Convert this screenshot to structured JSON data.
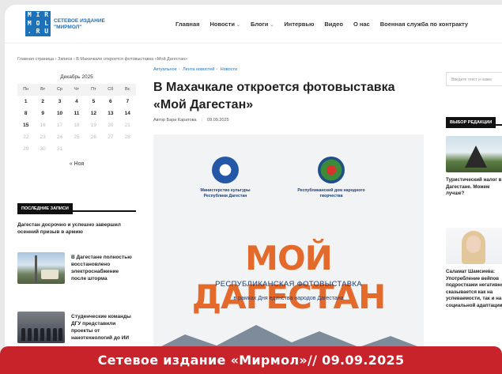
{
  "logo": {
    "letters": [
      "M",
      "I",
      "R",
      "M",
      "O",
      "L",
      ".",
      "R",
      "U"
    ],
    "title_line1": "СЕТЕВОЕ ИЗДАНИЕ",
    "title_line2": "\"МИРМОЛ\""
  },
  "nav": [
    {
      "label": "Главная",
      "dropdown": false
    },
    {
      "label": "Новости",
      "dropdown": true
    },
    {
      "label": "Блоги",
      "dropdown": true
    },
    {
      "label": "Интервью",
      "dropdown": false
    },
    {
      "label": "Видео",
      "dropdown": false
    },
    {
      "label": "О нас",
      "dropdown": false
    },
    {
      "label": "Военная служба по контракту",
      "dropdown": false
    }
  ],
  "breadcrumb": "Главная страница › Записи › В Махачкале откроется фотовыставка «Мой Дагестан»",
  "calendar": {
    "title": "Декабрь 2025",
    "weekdays": [
      "Пн",
      "Вт",
      "Ср",
      "Чт",
      "Пт",
      "Сб",
      "Вс"
    ],
    "days": [
      [
        "1",
        "2",
        "3",
        "4",
        "5",
        "6",
        "7"
      ],
      [
        "8",
        "9",
        "10",
        "11",
        "12",
        "13",
        "14"
      ],
      [
        "15",
        "16",
        "17",
        "18",
        "19",
        "20",
        "21"
      ],
      [
        "22",
        "23",
        "24",
        "25",
        "26",
        "27",
        "28"
      ],
      [
        "29",
        "30",
        "31",
        "",
        "",
        "",
        ""
      ]
    ],
    "prev_link": "« Ноя"
  },
  "recent": {
    "heading": "ПОСЛЕДНИЕ ЗАПИСИ",
    "post1": "Дагестан досрочно и успешно завершил осенний призыв в армию",
    "post2": "В Дагестане полностью восстановлено электроснабжение после шторма",
    "post3": "Студенческие команды ДГУ представили проекты от нанотехнологий до ИИ"
  },
  "article": {
    "tags": [
      "Актуальное",
      "Лента новостей",
      "Новости"
    ],
    "title": "В Махачкале откроется фотовыставка «Мой Дагестан»",
    "author": "Автор Бари Каратова",
    "date": "09.09.2025"
  },
  "hero": {
    "org1": "Министерство культуры Республики Дагестан",
    "org2": "Республиканский дом народного творчества",
    "title": "МОЙ ДАГЕСТАН",
    "subtitle": "РЕСПУБЛИКАНСКАЯ ФОТОВЫСТАВКА",
    "subtitle2": "в рамках Дня единства народов Дагестана"
  },
  "sidebar_right": {
    "search_placeholder": "Введите текст и нажм",
    "heading": "ВЫБОР РЕДАКЦИИ",
    "item1": "Туристический налог в Дагестане. Можем лучше?",
    "item2": "Саламат Шамсиева: Употребление вейпов подростками негативно сказывается как на успеваемости, так и на социальной адаптации"
  },
  "banner": "Сетевое издание «Мирмол»// 09.09.2025"
}
